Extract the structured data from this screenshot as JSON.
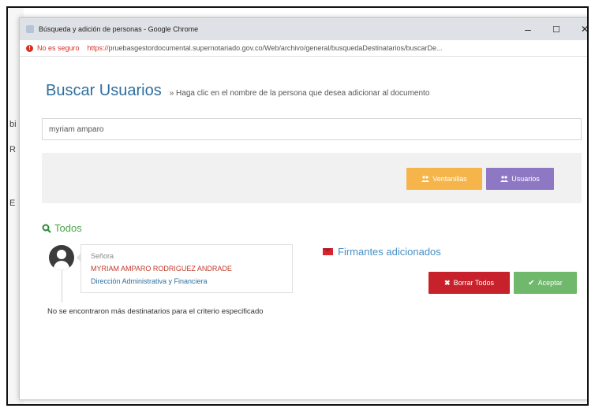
{
  "background_letters": [
    "bi",
    "R",
    "E"
  ],
  "window": {
    "title": "Búsqueda y adición de personas - Google Chrome",
    "controls": {
      "minimize": "–",
      "maximize": "☐",
      "close": "✕"
    }
  },
  "addressbar": {
    "security_label": "No es seguro",
    "protocol": "https://",
    "url": "pruebasgestordocumental.supernotariado.gov.co/Web/archivo/general/busquedaDestinatarios/buscarDe..."
  },
  "page": {
    "heading": "Buscar Usuarios",
    "hint": "» Haga clic en el nombre de la persona que desea adicionar al documento",
    "search": {
      "value": "myriam amparo",
      "placeholder": ""
    },
    "buttons": {
      "ventanillas": "Ventanillas",
      "usuarios": "Usuarios"
    },
    "results_filter": "Todos",
    "result": {
      "salutation": "Señora",
      "name": "MYRIAM AMPARO RODRIGUEZ ANDRADE",
      "department": "Dirección Administrativa y Financiera"
    },
    "no_more_message": "No se encontraron más destinatarios para el criterio especificado",
    "firmantes": {
      "title": "Firmantes adicionados",
      "clear_all": "Borrar Todos",
      "accept": "Aceptar"
    }
  },
  "colors": {
    "heading": "#2f6fa0",
    "ventanillas": "#f5b54a",
    "usuarios": "#8e78c3",
    "todos": "#4aa248",
    "borrar": "#c7222c",
    "aceptar": "#70b86b",
    "name": "#c0392b"
  },
  "icons": {
    "ventanillas_icon": "users-icon",
    "usuarios_icon": "users-icon",
    "todos_icon": "search-icon",
    "firmantes_icon": "envelope-icon",
    "borrar_icon": "x-icon",
    "aceptar_icon": "checkmark-icon"
  }
}
